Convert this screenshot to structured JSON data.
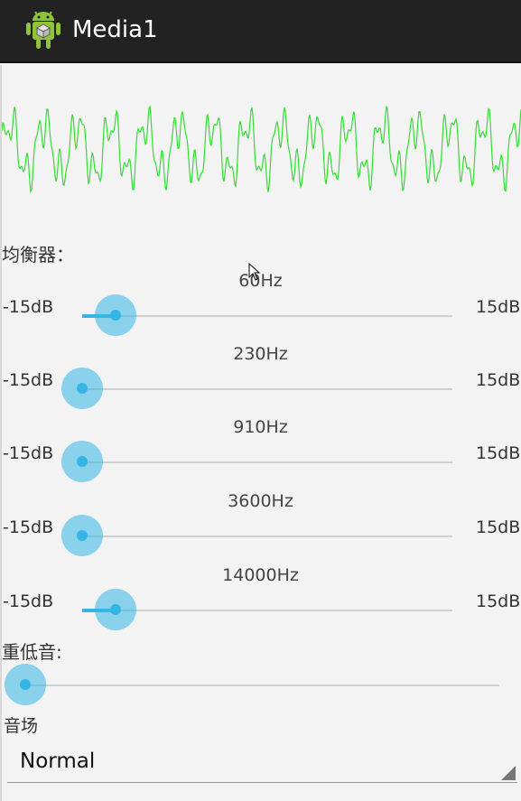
{
  "app": {
    "title": "Media1",
    "icon": "android-icon"
  },
  "visualizer": {
    "color": "#33dd33"
  },
  "equalizer": {
    "label": "均衡器：",
    "bands": [
      {
        "freq": "60Hz",
        "min": "-15dB",
        "max": "15dB",
        "level": 0.09
      },
      {
        "freq": "230Hz",
        "min": "-15dB",
        "max": "15dB",
        "level": 0.0
      },
      {
        "freq": "910Hz",
        "min": "-15dB",
        "max": "15dB",
        "level": 0.0
      },
      {
        "freq": "3600Hz",
        "min": "-15dB",
        "max": "15dB",
        "level": 0.0
      },
      {
        "freq": "14000Hz",
        "min": "-15dB",
        "max": "15dB",
        "level": 0.09
      }
    ]
  },
  "bass": {
    "label": "重低音:",
    "level": 0.0
  },
  "reverb": {
    "label": "音场",
    "selected": "Normal"
  },
  "colors": {
    "accent": "#33b5e5",
    "actionbar": "#222222"
  }
}
